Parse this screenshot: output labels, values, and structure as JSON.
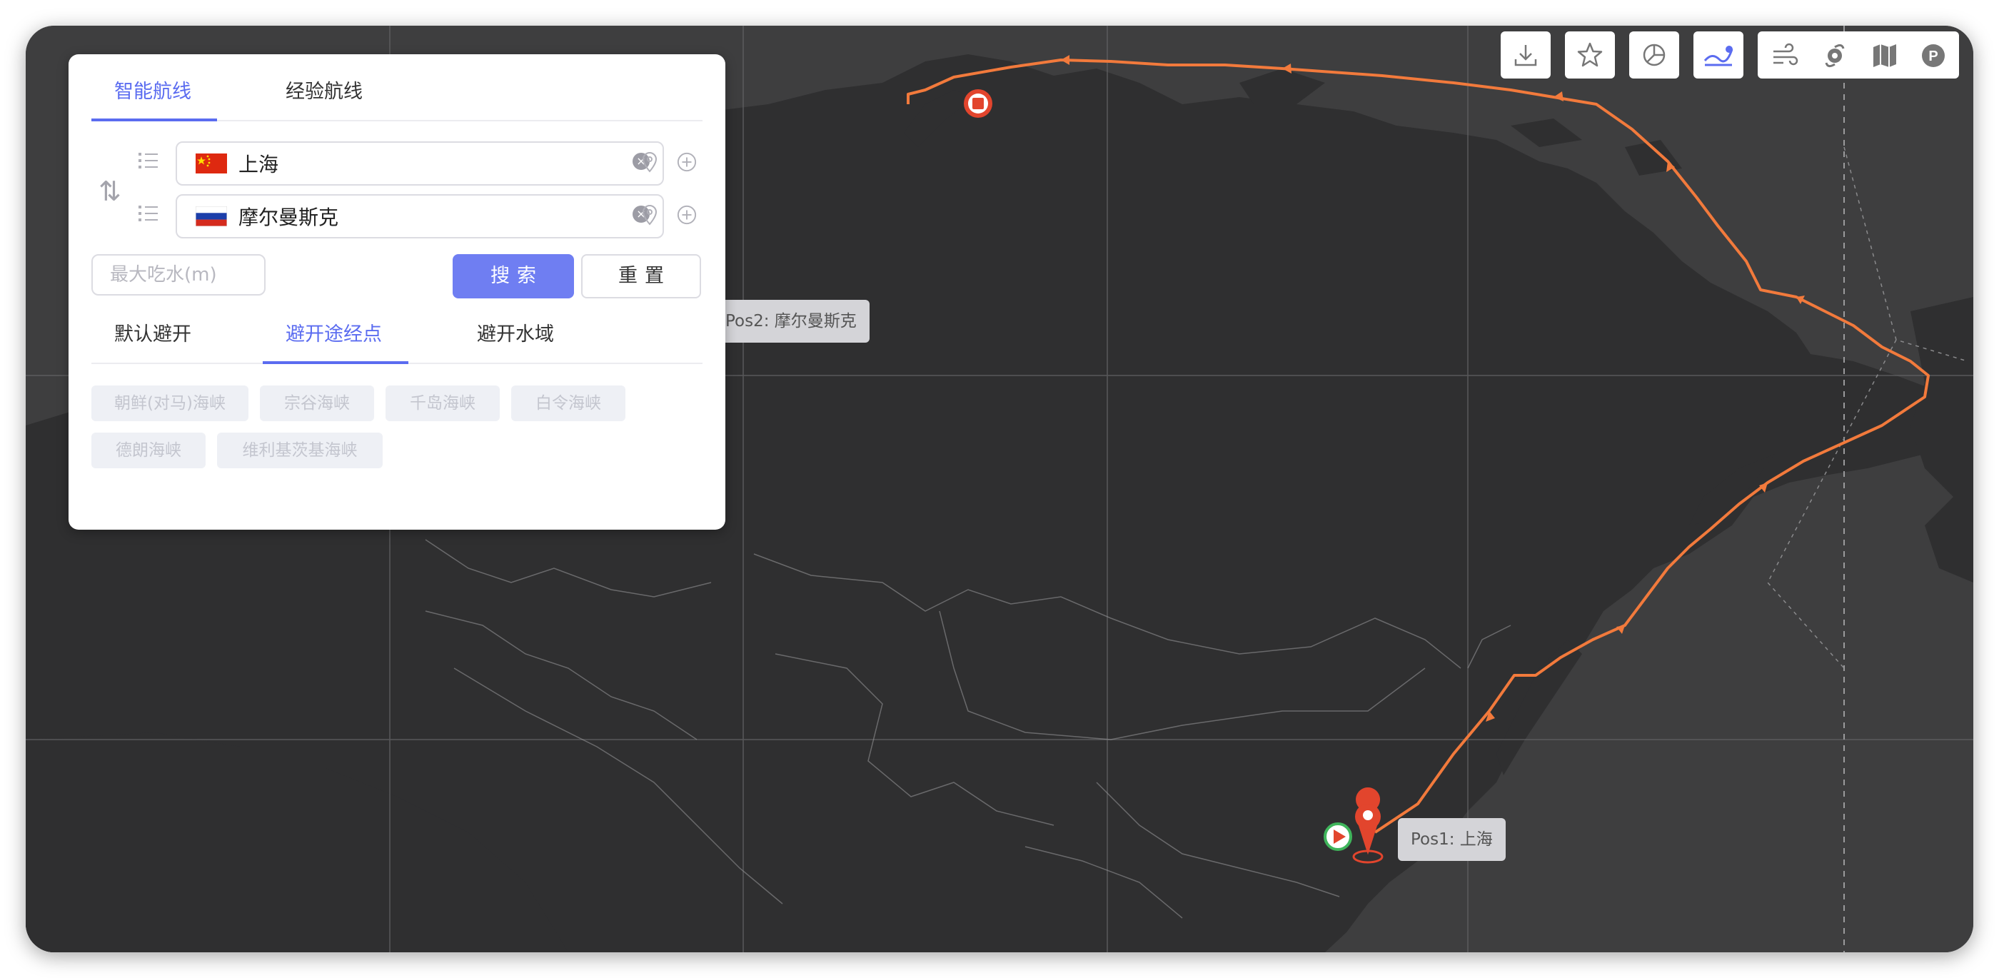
{
  "route_panel": {
    "mode_tabs": [
      "智能航线",
      "经验航线"
    ],
    "active_mode_tab": 0,
    "origin": {
      "country_flag": "china-flag-icon",
      "value": "上海"
    },
    "destination": {
      "country_flag": "russia-flag-icon",
      "value": "摩尔曼斯克"
    },
    "max_draft_placeholder": "最大吃水(m)",
    "search_label": "搜索",
    "reset_label": "重置",
    "avoid_tabs": [
      "默认避开",
      "避开途经点",
      "避开水域"
    ],
    "active_avoid_tab": 1,
    "waypoints": [
      "朝鲜(对马)海峡",
      "宗谷海峡",
      "千岛海峡",
      "白令海峡",
      "德朗海峡",
      "维利基茨基海峡"
    ]
  },
  "toolbar": {
    "single_buttons": [
      "download-icon",
      "star-icon",
      "pie-chart-icon",
      "route-icon"
    ],
    "active_button": "route-icon",
    "layer_buttons": [
      "wind-icon",
      "typhoon-icon",
      "map-icon",
      "parking-icon"
    ]
  },
  "map": {
    "start_label": "Pos1: 上海",
    "end_label": "Pos2: 摩尔曼斯克",
    "route_color": "#f27a3c",
    "marker_color": "#e2452d",
    "start_icon_color": "#3fb55b",
    "land_color": "#2f2f30",
    "sea_color": "#3e3e3f"
  }
}
